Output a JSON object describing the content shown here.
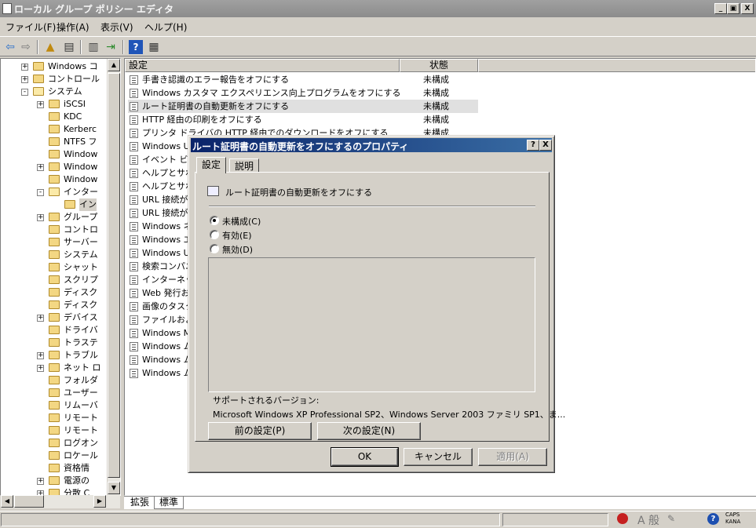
{
  "window": {
    "title": "ローカル グループ ポリシー エディタ",
    "caption_buttons": [
      "_",
      "▣",
      "X"
    ]
  },
  "menu": [
    "ファイル(F)",
    "操作(A)",
    "表示(V)",
    "ヘルプ(H)"
  ],
  "toolbar": {
    "icons": [
      "back-icon",
      "forward-icon",
      "up-folder-icon",
      "show-hide-tree-icon",
      "properties-icon",
      "export-icon",
      "help-icon",
      "view-icon"
    ]
  },
  "tree": {
    "items": [
      {
        "label": "Windows コ",
        "expander": "+"
      },
      {
        "label": "コントロール",
        "expander": "+"
      },
      {
        "label": "システム",
        "expander": "-"
      },
      {
        "label": "iSCSI",
        "expander": "+"
      },
      {
        "label": "KDC",
        "expander": ""
      },
      {
        "label": "Kerberc",
        "expander": ""
      },
      {
        "label": "NTFS フ",
        "expander": ""
      },
      {
        "label": "Window",
        "expander": ""
      },
      {
        "label": "Window",
        "expander": "+"
      },
      {
        "label": "Window",
        "expander": ""
      },
      {
        "label": "インター",
        "expander": "-"
      },
      {
        "label": "イン",
        "expander": ""
      },
      {
        "label": "グループ",
        "expander": "+"
      },
      {
        "label": "コントロ",
        "expander": ""
      },
      {
        "label": "サーバー",
        "expander": ""
      },
      {
        "label": "システム",
        "expander": ""
      },
      {
        "label": "シャット",
        "expander": ""
      },
      {
        "label": "スクリプ",
        "expander": ""
      },
      {
        "label": "ディスク",
        "expander": ""
      },
      {
        "label": "ディスク",
        "expander": ""
      },
      {
        "label": "デバイス",
        "expander": "+"
      },
      {
        "label": "ドライバ",
        "expander": ""
      },
      {
        "label": "トラステ",
        "expander": ""
      },
      {
        "label": "トラブル",
        "expander": "+"
      },
      {
        "label": "ネット ロ",
        "expander": "+"
      },
      {
        "label": "フォルダ",
        "expander": ""
      },
      {
        "label": "ユーザー",
        "expander": ""
      },
      {
        "label": "リムーバ",
        "expander": ""
      },
      {
        "label": "リモート",
        "expander": ""
      },
      {
        "label": "リモート",
        "expander": ""
      },
      {
        "label": "ログオン",
        "expander": ""
      },
      {
        "label": "ロケール",
        "expander": ""
      },
      {
        "label": "資格情",
        "expander": ""
      },
      {
        "label": "電源の",
        "expander": "+"
      },
      {
        "label": "分散 C",
        "expander": "+"
      }
    ]
  },
  "list": {
    "columns": [
      "設定",
      "状態"
    ],
    "rows": [
      {
        "name": "手書き認識のエラー報告をオフにする",
        "state": "未構成"
      },
      {
        "name": "Windows カスタマ エクスペリエンス向上プログラムをオフにする",
        "state": "未構成"
      },
      {
        "name": "ルート証明書の自動更新をオフにする",
        "state": "未構成",
        "selected": true
      },
      {
        "name": "HTTP 経由の印刷をオフにする",
        "state": "未構成"
      },
      {
        "name": "プリンタ ドライバの HTTP 経由でのダウンロードをオフにする",
        "state": "未構成"
      },
      {
        "name": "Windows Up",
        "state": ""
      },
      {
        "name": "イベント ビュ",
        "state": ""
      },
      {
        "name": "ヘルプとサポ",
        "state": ""
      },
      {
        "name": "ヘルプとサポ",
        "state": ""
      },
      {
        "name": "URL 接続が",
        "state": ""
      },
      {
        "name": "URL 接続が",
        "state": ""
      },
      {
        "name": "Windows ネ",
        "state": ""
      },
      {
        "name": "Windows エ",
        "state": ""
      },
      {
        "name": "Windows Up",
        "state": ""
      },
      {
        "name": "検索コンパニ",
        "state": ""
      },
      {
        "name": "インターネット",
        "state": ""
      },
      {
        "name": "Web 発行お",
        "state": ""
      },
      {
        "name": "画像のタスク",
        "state": ""
      },
      {
        "name": "ファイルおよび",
        "state": ""
      },
      {
        "name": "Windows M",
        "state": ""
      },
      {
        "name": "Windows ム",
        "state": ""
      },
      {
        "name": "Windows ム",
        "state": ""
      },
      {
        "name": "Windows ム",
        "state": ""
      }
    ]
  },
  "view_tabs": [
    "拡張",
    "標準"
  ],
  "dialog": {
    "title": "ルート証明書の自動更新をオフにするのプロパティ",
    "caption_buttons": [
      "?",
      "X"
    ],
    "tabs": [
      "設定",
      "説明"
    ],
    "policy_name": "ルート証明書の自動更新をオフにする",
    "options": [
      {
        "label": "未構成(C)",
        "checked": true
      },
      {
        "label": "有効(E)",
        "checked": false
      },
      {
        "label": "無効(D)",
        "checked": false
      }
    ],
    "supported_label": "サポートされるバージョン:",
    "supported_value": "Microsoft Windows XP Professional SP2、Windows Server 2003 ファミリ SP1、ま...",
    "prev_button": "前の設定(P)",
    "next_button": "次の設定(N)",
    "ok_button": "OK",
    "cancel_button": "キャンセル",
    "apply_button": "適用(A)"
  },
  "statusbar": {
    "ime_mode": "A 般",
    "caps": "CAPS",
    "kana": "KANA"
  }
}
